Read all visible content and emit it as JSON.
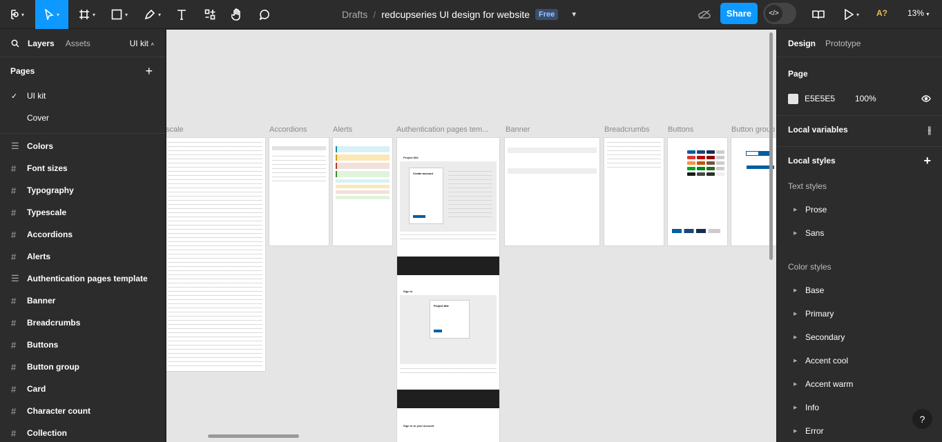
{
  "toolbar": {
    "breadcrumb": "Drafts",
    "file_name": "redcupseries UI design for website",
    "plan_badge": "Free",
    "share_label": "Share",
    "font_warning": "A?",
    "zoom": "13%"
  },
  "left_panel": {
    "tab_layers": "Layers",
    "tab_assets": "Assets",
    "library_name": "UI kit",
    "pages_title": "Pages",
    "pages": [
      {
        "label": "UI kit",
        "selected": true
      },
      {
        "label": "Cover",
        "selected": false
      }
    ],
    "layers": [
      {
        "label": "Colors",
        "icon": "section-icon"
      },
      {
        "label": "Font sizes",
        "icon": "frame-icon"
      },
      {
        "label": "Typography",
        "icon": "frame-icon"
      },
      {
        "label": "Typescale",
        "icon": "frame-icon"
      },
      {
        "label": "Accordions",
        "icon": "frame-icon"
      },
      {
        "label": "Alerts",
        "icon": "frame-icon"
      },
      {
        "label": "Authentication pages template",
        "icon": "section-icon"
      },
      {
        "label": "Banner",
        "icon": "frame-icon"
      },
      {
        "label": "Breadcrumbs",
        "icon": "frame-icon"
      },
      {
        "label": "Buttons",
        "icon": "frame-icon"
      },
      {
        "label": "Button group",
        "icon": "frame-icon"
      },
      {
        "label": "Card",
        "icon": "frame-icon"
      },
      {
        "label": "Character count",
        "icon": "frame-icon"
      },
      {
        "label": "Collection",
        "icon": "frame-icon"
      }
    ]
  },
  "canvas": {
    "background": "#E5E5E5",
    "frame_labels": [
      "scale",
      "Accordions",
      "Alerts",
      "Authentication pages tem...",
      "Banner",
      "Breadcrumbs",
      "Buttons",
      "Button group"
    ],
    "auth_texts": [
      "Project title",
      "Create account",
      "Sign in",
      "Project title",
      "Sign in to your account"
    ]
  },
  "right_panel": {
    "tab_design": "Design",
    "tab_prototype": "Prototype",
    "page_section": "Page",
    "page_color": "E5E5E5",
    "page_opacity": "100%",
    "local_variables": "Local variables",
    "local_styles": "Local styles",
    "text_styles_title": "Text styles",
    "text_styles": [
      "Prose",
      "Sans"
    ],
    "color_styles_title": "Color styles",
    "color_styles": [
      "Base",
      "Primary",
      "Secondary",
      "Accent cool",
      "Accent warm",
      "Info",
      "Error"
    ],
    "help": "?"
  }
}
